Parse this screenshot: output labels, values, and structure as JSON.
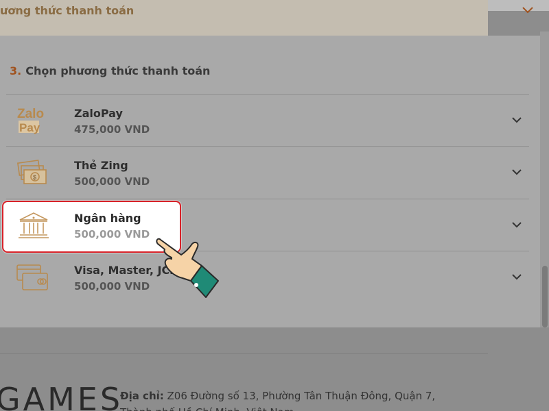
{
  "top_bar": {
    "label": "ương thức thanh toán"
  },
  "step": {
    "number": "3.",
    "title": "Chọn phương thức thanh toán"
  },
  "methods": [
    {
      "name": "ZaloPay",
      "amount": "475,000 VND",
      "icon": "zalopay-icon",
      "icon_text_1": "Zalo",
      "icon_text_2": "Pay"
    },
    {
      "name": "Thẻ Zing",
      "amount": "500,000 VND",
      "icon": "zing-card-icon"
    },
    {
      "name": "Ngân hàng",
      "amount": "500,000 VND",
      "icon": "bank-icon",
      "highlighted": true
    },
    {
      "name": "Visa, Master, JCB",
      "amount": "500,000 VND",
      "icon": "credit-card-icon"
    }
  ],
  "footer": {
    "logo": "GAMES",
    "address_label": "Địa chỉ:",
    "address_line1": " Z06 Đường số 13, Phường Tân Thuận Đông, Quận 7,",
    "address_line2": "Thành phố Hồ Chí Minh, Việt Nam"
  },
  "colors": {
    "accent": "#d8232a",
    "icon": "#c4975e",
    "step_number": "#a0521e"
  }
}
